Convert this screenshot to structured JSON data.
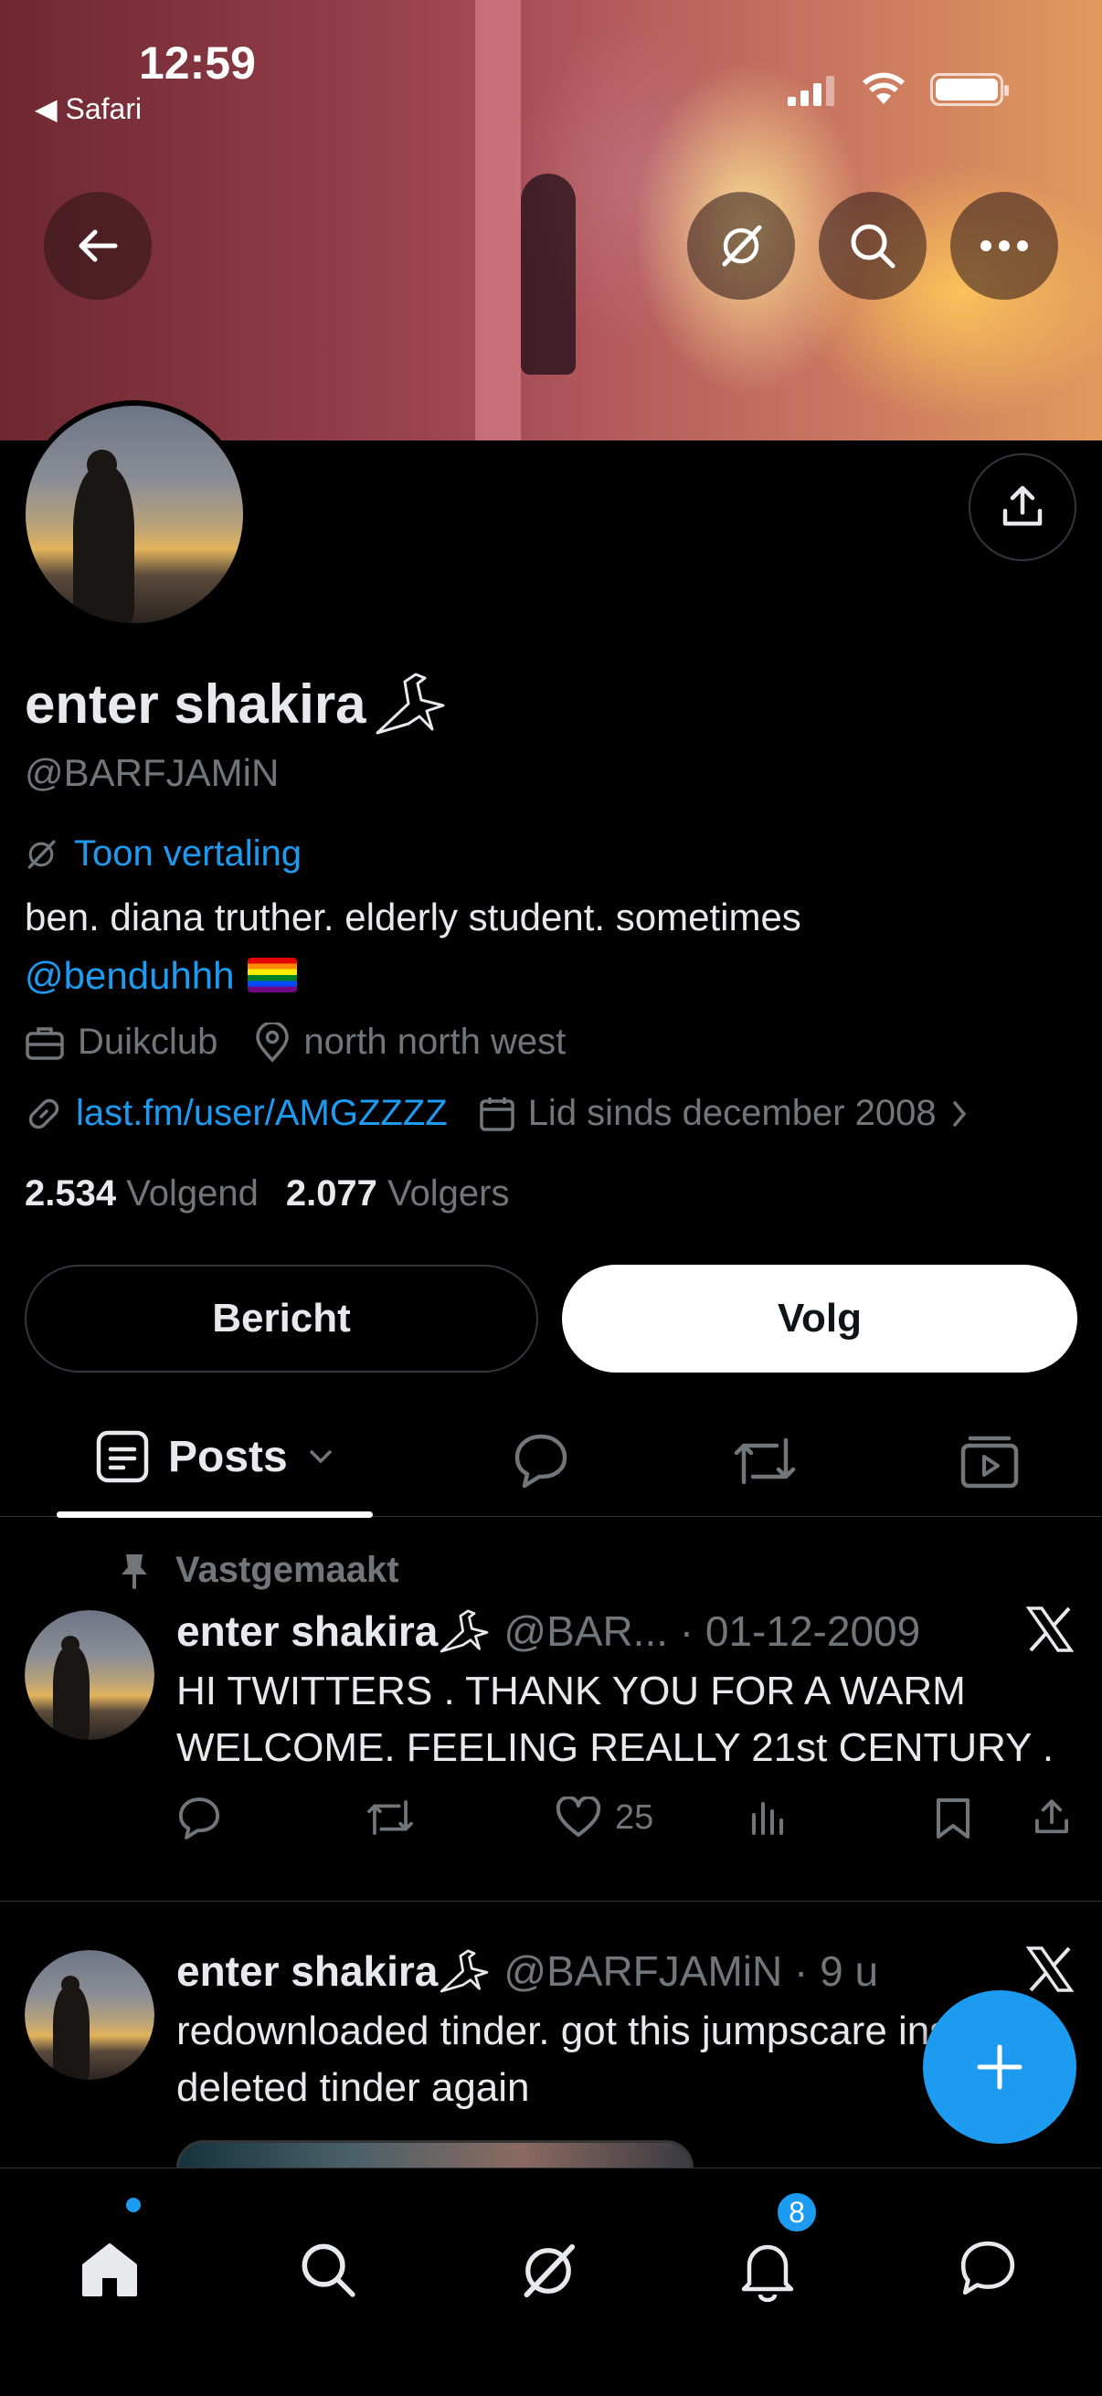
{
  "status_bar": {
    "time": "12:59",
    "back_app": "◀ Safari"
  },
  "profile": {
    "display_name": "enter shakira",
    "handle": "@BARFJAMiN",
    "translate_label": "Toon vertaling",
    "bio_text": "ben. diana truther. elderly student. sometimes",
    "bio_mention": "@benduhhh",
    "job": "Duikclub",
    "location": "north north west",
    "website": "last.fm/user/AMGZZZZ",
    "joined": "Lid sinds december 2008",
    "following_count": "2.534",
    "following_label": "Volgend",
    "followers_count": "2.077",
    "followers_label": "Volgers"
  },
  "buttons": {
    "message": "Bericht",
    "follow": "Volg"
  },
  "tabs": {
    "posts": "Posts"
  },
  "posts": [
    {
      "pinned_label": "Vastgemaakt",
      "name": "enter shakira",
      "meta": "@BAR... · 01-12-2009",
      "text": "HI TWITTERS . THANK YOU FOR A WARM WELCOME. FEELING REALLY 21st CENTURY .",
      "likes": "25"
    },
    {
      "name": "enter shakira",
      "meta": "@BARFJAMiN · 9 u",
      "text": "redownloaded tinder. got this jumpscare instantly deleted tinder again"
    }
  ],
  "nav": {
    "notifications_badge": "8"
  },
  "colors": {
    "accent": "#1d9bf0",
    "background": "#000000",
    "secondary_text": "#71767b"
  }
}
